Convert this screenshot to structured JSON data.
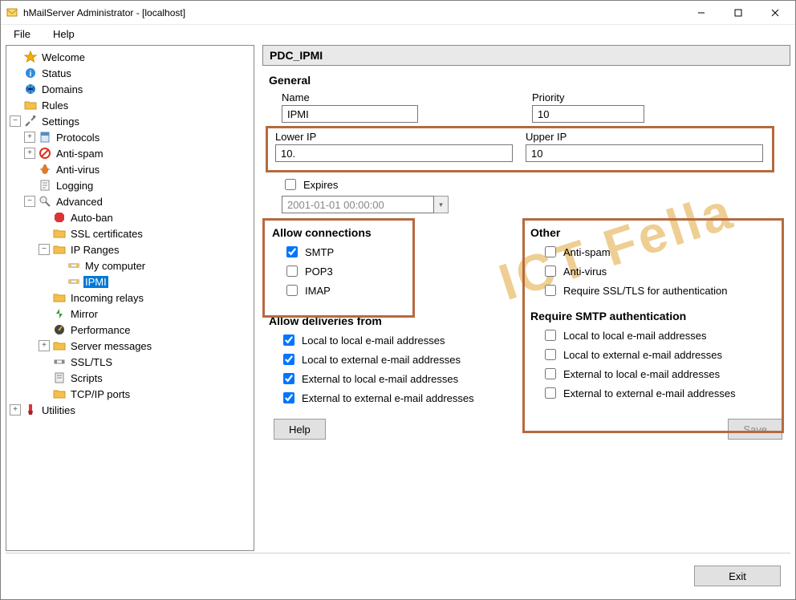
{
  "window": {
    "title": "hMailServer Administrator - [localhost]"
  },
  "menu": {
    "file": "File",
    "help": "Help"
  },
  "tree": {
    "welcome": "Welcome",
    "status": "Status",
    "domains": "Domains",
    "rules": "Rules",
    "settings": "Settings",
    "protocols": "Protocols",
    "antispam": "Anti-spam",
    "antivirus": "Anti-virus",
    "logging": "Logging",
    "advanced": "Advanced",
    "autoban": "Auto-ban",
    "sslcerts": "SSL certificates",
    "ipranges": "IP Ranges",
    "mycomputer": "My computer",
    "ipmi": "IPMI",
    "incoming": "Incoming relays",
    "mirror": "Mirror",
    "performance": "Performance",
    "servermsgs": "Server messages",
    "ssltls": "SSL/TLS",
    "scripts": "Scripts",
    "tcpip": "TCP/IP ports",
    "utilities": "Utilities"
  },
  "panel": {
    "title": "PDC_IPMI",
    "general": "General",
    "name_label": "Name",
    "name_value": "IPMI",
    "priority_label": "Priority",
    "priority_value": "10",
    "lowerip_label": "Lower IP",
    "lowerip_value": "10.",
    "upperip_label": "Upper IP",
    "upperip_value": "10",
    "expires_label": "Expires",
    "expires_date": "2001-01-01 00:00:00",
    "allow_conn": "Allow connections",
    "smtp": "SMTP",
    "pop3": "POP3",
    "imap": "IMAP",
    "allow_deliv": "Allow deliveries from",
    "l2l": "Local to local e-mail addresses",
    "l2e": "Local to external e-mail addresses",
    "e2l": "External to local e-mail addresses",
    "e2e": "External to external e-mail addresses",
    "other": "Other",
    "o_antispam": "Anti-spam",
    "o_antivirus": "Anti-virus",
    "o_ssl": "Require SSL/TLS for authentication",
    "req_auth": "Require SMTP authentication",
    "help_btn": "Help",
    "save_btn": "Save",
    "exit_btn": "Exit"
  },
  "watermark": "ICT Fella"
}
